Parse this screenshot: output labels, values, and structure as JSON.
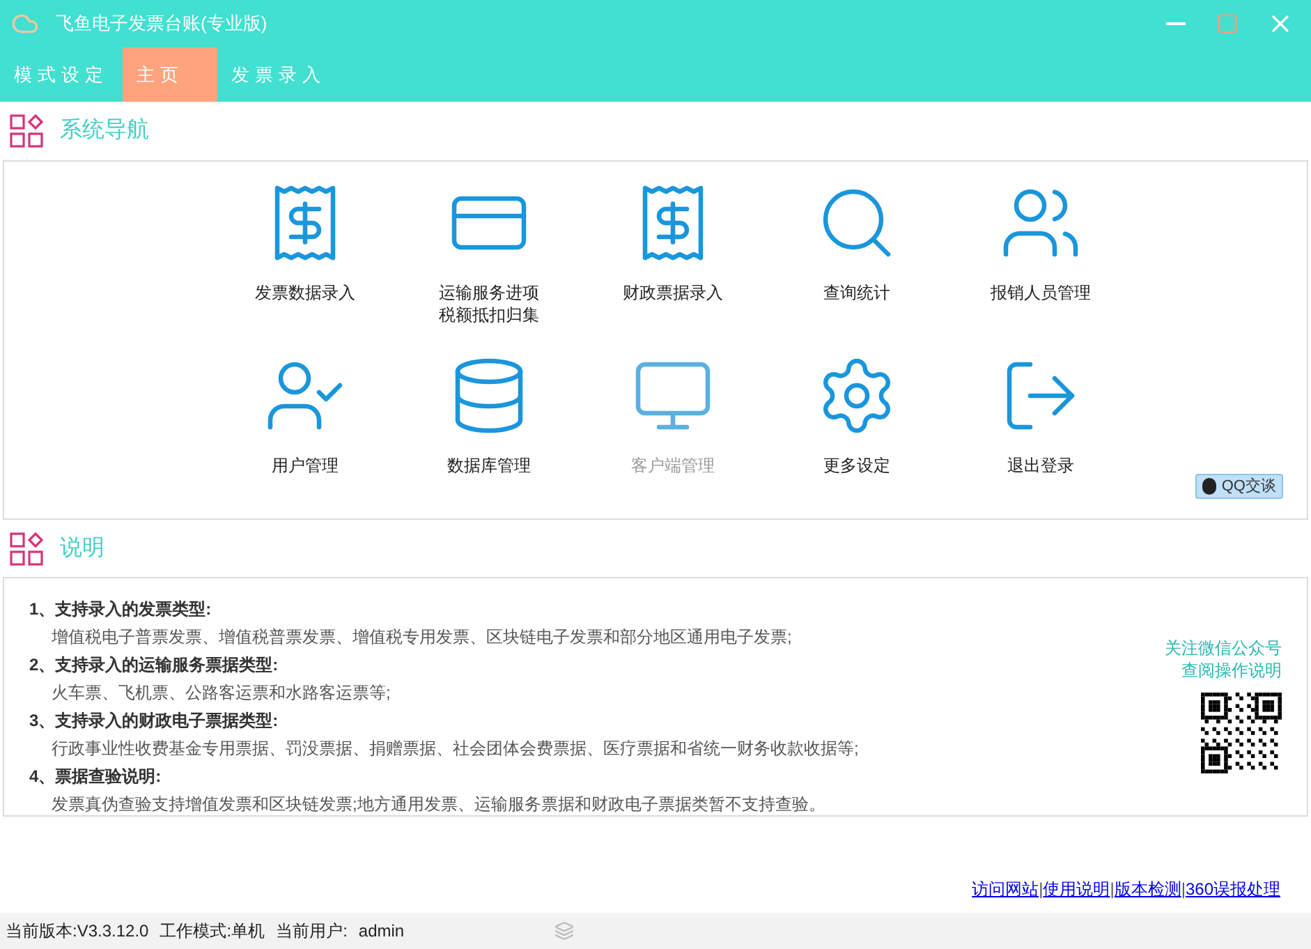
{
  "window": {
    "title": "飞鱼电子发票台账(专业版)"
  },
  "tabs": [
    {
      "label": "模式设定",
      "selected": false
    },
    {
      "label": "主页",
      "selected": true
    },
    {
      "label": "发票录入",
      "selected": false
    }
  ],
  "nav_section": {
    "title": "系统导航"
  },
  "nav_items": [
    {
      "label": "发票数据录入",
      "disabled": false
    },
    {
      "label": "运输服务进项税额抵扣归集",
      "disabled": false
    },
    {
      "label": "财政票据录入",
      "disabled": false
    },
    {
      "label": "查询统计",
      "disabled": false
    },
    {
      "label": "报销人员管理",
      "disabled": false
    },
    {
      "label": "用户管理",
      "disabled": false
    },
    {
      "label": "数据库管理",
      "disabled": false
    },
    {
      "label": "客户端管理",
      "disabled": true
    },
    {
      "label": "更多设定",
      "disabled": false
    },
    {
      "label": "退出登录",
      "disabled": false
    }
  ],
  "qq_button": {
    "label": "QQ交谈"
  },
  "info_section": {
    "title": "说明"
  },
  "info_items": [
    {
      "heading": "1、支持录入的发票类型:",
      "text": "增值税电子普票发票、增值税普票发票、增值税专用发票、区块链电子发票和部分地区通用电子发票;"
    },
    {
      "heading": "2、支持录入的运输服务票据类型:",
      "text": "火车票、飞机票、公路客运票和水路客运票等;"
    },
    {
      "heading": "3、支持录入的财政电子票据类型:",
      "text": "行政事业性收费基金专用票据、罚没票据、捐赠票据、社会团体会费票据、医疗票据和省统一财务收款收据等;"
    },
    {
      "heading": "4、票据查验说明:",
      "text": "发票真伪查验支持增值发票和区块链发票;地方通用发票、运输服务票据和财政电子票据类暂不支持查验。"
    }
  ],
  "wechat_note": [
    "关注微信公众号",
    "查阅操作说明"
  ],
  "links": {
    "separator": "|",
    "items": [
      "访问网站",
      "使用说明",
      "版本检测",
      "360误报处理"
    ]
  },
  "status_bar": {
    "version": "当前版本:V3.3.12.0",
    "mode": "工作模式:单机",
    "user_label": "当前用户:",
    "user": "admin"
  }
}
